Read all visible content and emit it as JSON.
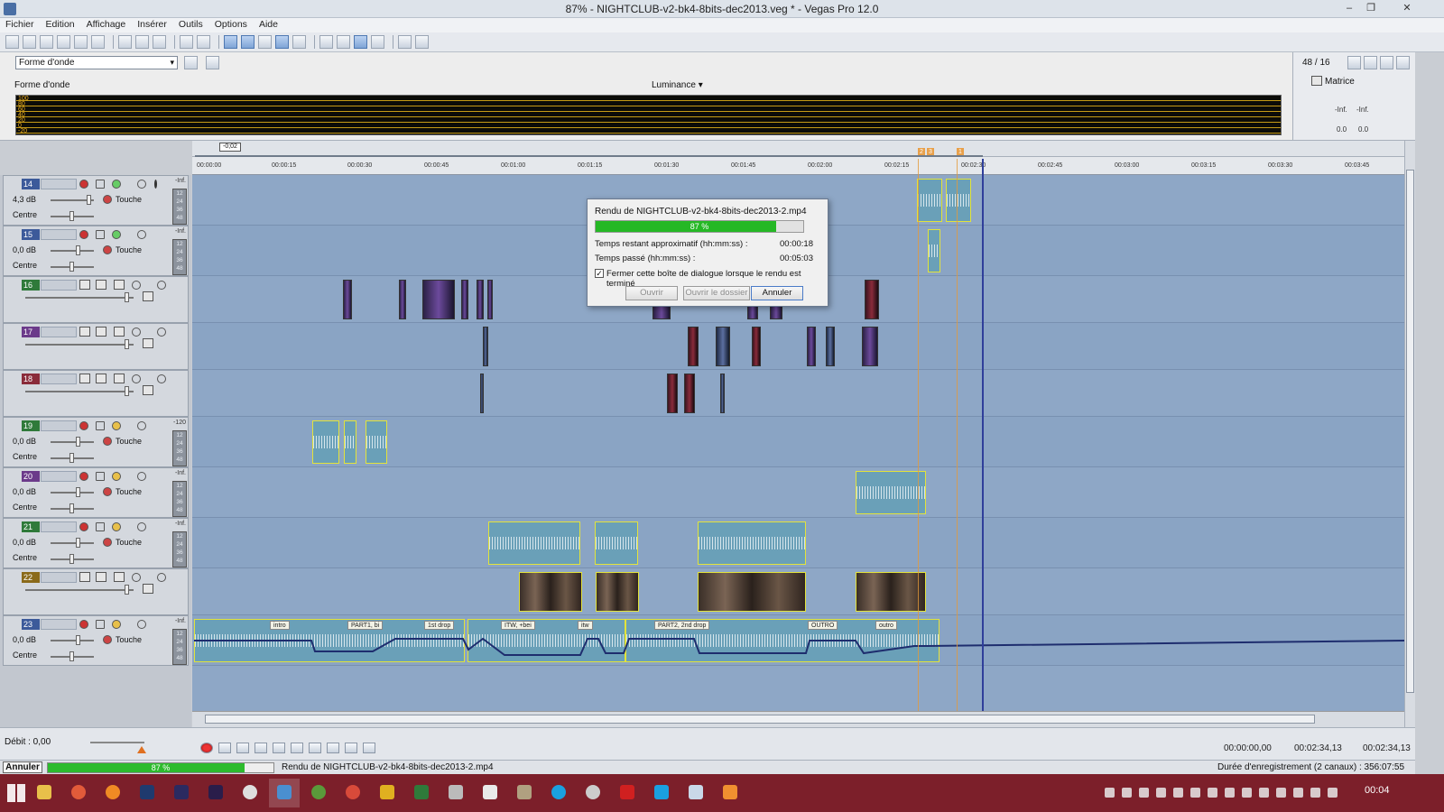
{
  "window": {
    "title": "87% - NIGHTCLUB-v2-bk4-8bits-dec2013.veg * - Vegas Pro 12.0",
    "minimize": "–",
    "restore": "❐",
    "close": "✕"
  },
  "menu": [
    "Fichier",
    "Edition",
    "Affichage",
    "Insérer",
    "Outils",
    "Options",
    "Aide"
  ],
  "scope": {
    "select_value": "Forme d'onde",
    "title": "Forme d'onde",
    "luminance": "Luminance ▾",
    "scale_labels": [
      "100",
      "80",
      "60",
      "40",
      "20",
      "0",
      "-20"
    ]
  },
  "mixer": {
    "count": "48 / 16",
    "label": "Matrice",
    "left_inf": "-Inf.",
    "right_inf": "-Inf.",
    "left_val": "0.0",
    "right_val": "0.0"
  },
  "ruler": {
    "offset": "-0;02",
    "ticks": [
      "00:00:00",
      "00:00:15",
      "00:00:30",
      "00:00:45",
      "00:01:00",
      "00:01:15",
      "00:01:30",
      "00:01:45",
      "00:02:00",
      "00:02:15",
      "00:02:30",
      "00:02:45",
      "00:03:00",
      "00:03:15",
      "00:03:30",
      "00:03:45"
    ],
    "markers": [
      "2",
      "3",
      "1"
    ]
  },
  "meter_scale": [
    "12",
    "24",
    "36",
    "48"
  ],
  "tracks": [
    {
      "num": "14",
      "type": "audio",
      "vol": "4,3 dB",
      "touch": "Touche",
      "pan": "Centre",
      "top": "-Inf."
    },
    {
      "num": "15",
      "type": "audio",
      "vol": "0,0 dB",
      "touch": "Touche",
      "pan": "Centre",
      "top": "-Inf."
    },
    {
      "num": "16",
      "type": "video"
    },
    {
      "num": "17",
      "type": "video"
    },
    {
      "num": "18",
      "type": "video"
    },
    {
      "num": "19",
      "type": "audio",
      "vol": "0,0 dB",
      "touch": "Touche",
      "pan": "Centre",
      "top": "-120"
    },
    {
      "num": "20",
      "type": "audio",
      "vol": "0,0 dB",
      "touch": "Touche",
      "pan": "Centre",
      "top": "-Inf."
    },
    {
      "num": "21",
      "type": "audio",
      "vol": "0,0 dB",
      "touch": "Touche",
      "pan": "Centre",
      "top": "-Inf."
    },
    {
      "num": "22",
      "type": "video"
    },
    {
      "num": "23",
      "type": "audio",
      "vol": "0,0 dB",
      "touch": "Touche",
      "pan": "Centre",
      "top": "-Inf."
    }
  ],
  "regions": [
    "intro",
    "PART1, bi",
    "1st drop",
    "ITW, +bei",
    "itw",
    "PART2, 2nd drop",
    "OUTRO",
    "outro"
  ],
  "dialog": {
    "title": "Rendu de NIGHTCLUB-v2-bk4-8bits-dec2013-2.mp4",
    "progress_label": "87 %",
    "progress": 87,
    "remaining_label": "Temps restant approximatif (hh:mm:ss) :",
    "remaining_value": "00:00:18",
    "elapsed_label": "Temps passé (hh:mm:ss) :",
    "elapsed_value": "00:05:03",
    "checkbox_label": "Fermer cette boîte de dialogue lorsque le rendu est terminé",
    "checked": true,
    "open_button": "Ouvrir",
    "open_folder_button": "Ouvrir le dossier",
    "cancel_button": "Annuler"
  },
  "transport": {
    "debit": "Débit : 0,00",
    "time_cursor": "00:00:00,00",
    "time_end": "00:02:34,13",
    "time_length": "00:02:34,13"
  },
  "status": {
    "cancel_label": "Annuler",
    "progress_label": "87 %",
    "progress": 87,
    "text": "Rendu de NIGHTCLUB-v2-bk4-8bits-dec2013-2.mp4",
    "record_info": "Durée d'enregistrement (2 canaux) : 356:07:55"
  },
  "taskbar": {
    "clock": "00:04"
  },
  "colors": {
    "track_14": "#3c5a9a",
    "track_15": "#3c5a9a",
    "track_16": "#2f7a3a",
    "track_17": "#6b3a8a",
    "track_18": "#8a2b3a",
    "track_19": "#2f7a3a",
    "track_20": "#6b3a8a",
    "track_21": "#2f7a3a",
    "track_22": "#8a6a1a",
    "track_23": "#3c5a9a",
    "progress": "#25b825"
  }
}
